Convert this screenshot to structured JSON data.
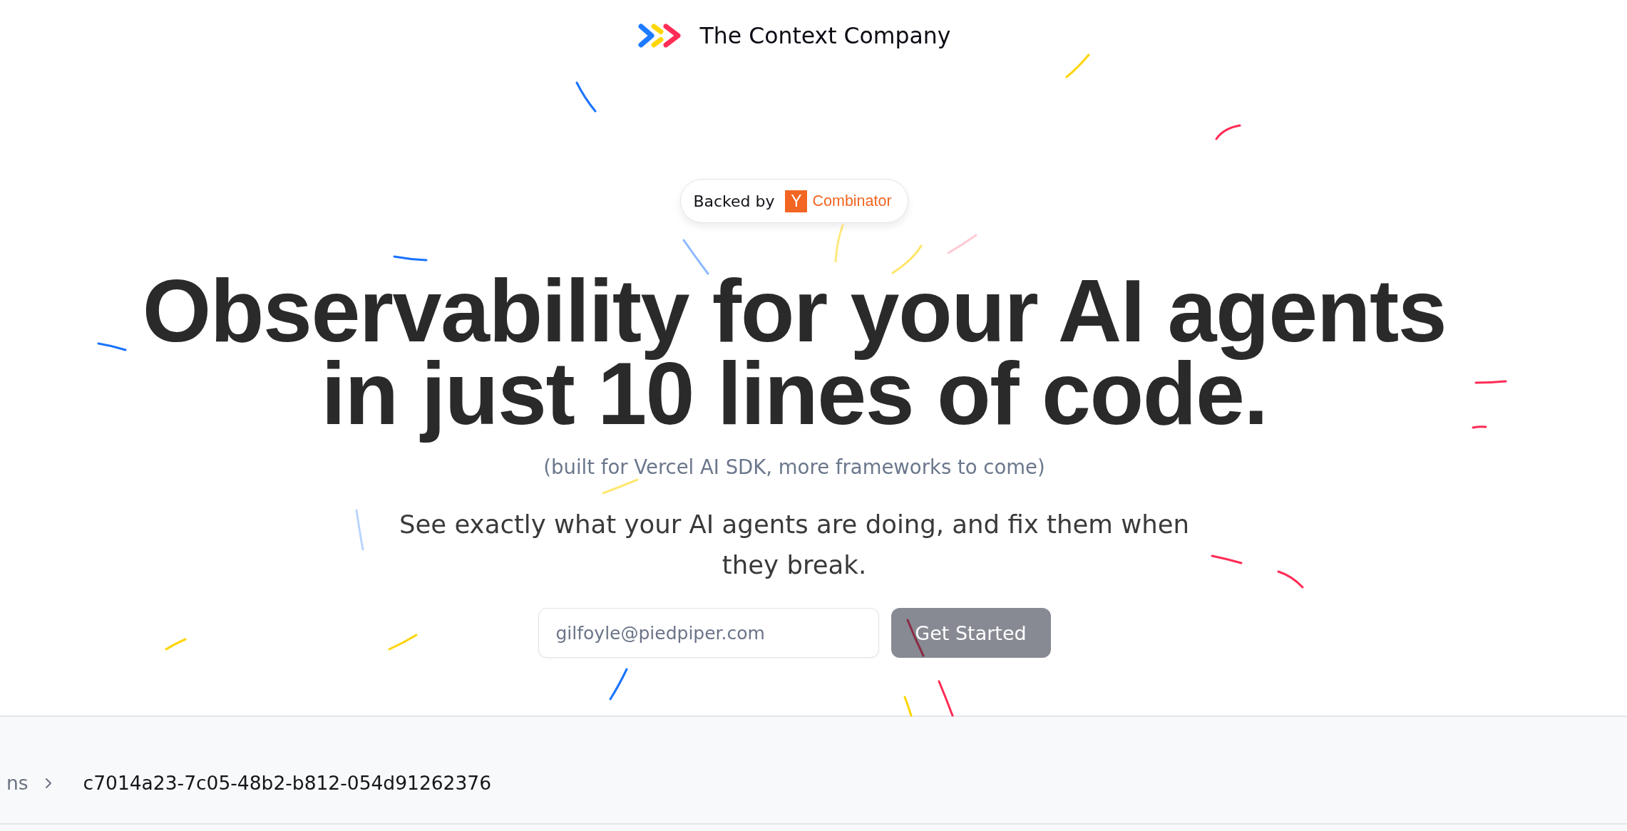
{
  "header": {
    "brand": "The Context Company"
  },
  "badge": {
    "label": "Backed by",
    "logo_mark": "Y",
    "logo_text": "Combinator"
  },
  "hero": {
    "headline": "Observability for your AI agents in just 10 lines of code.",
    "note": "(built for Vercel AI SDK, more frameworks to come)",
    "description": "See exactly what your AI agents are doing, and fix them when they break."
  },
  "signup": {
    "email_field": {
      "placeholder": "gilfoyle@piedpiper.com"
    },
    "button": {
      "label": "Get Started",
      "disabled": true
    }
  },
  "breadcrumb": [
    {
      "label": "ns",
      "current": false
    },
    {
      "label": "c7014a23-7c05-48b2-b812-054d91262376",
      "current": true
    }
  ]
}
